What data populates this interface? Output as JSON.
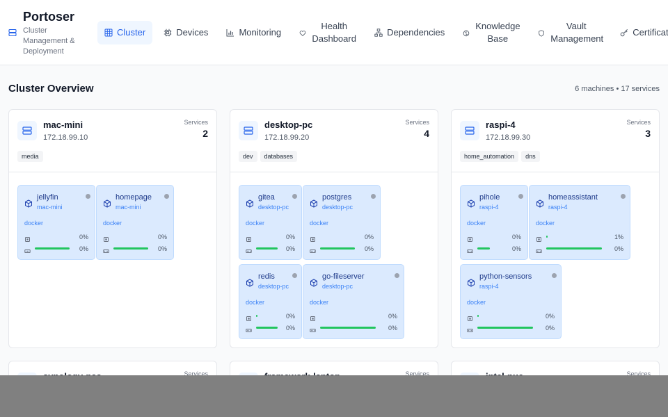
{
  "brand": {
    "title": "Portoser",
    "subtitle": "Cluster Management & Deployment",
    "logo_icon": "server-stack-icon"
  },
  "nav": [
    {
      "label": "Cluster",
      "icon": "grid-icon",
      "active": true
    },
    {
      "label": "Devices",
      "icon": "chip-icon",
      "active": false
    },
    {
      "label": "Monitoring",
      "icon": "bar-chart-icon",
      "active": false
    },
    {
      "label": "Health Dashboard",
      "icon": "heart-icon",
      "active": false
    },
    {
      "label": "Dependencies",
      "icon": "network-icon",
      "active": false
    },
    {
      "label": "Knowledge Base",
      "icon": "brain-icon",
      "active": false
    },
    {
      "label": "Vault Management",
      "icon": "shield-icon",
      "active": false
    },
    {
      "label": "Certificates",
      "icon": "key-icon",
      "active": false
    }
  ],
  "overview": {
    "title": "Cluster Overview",
    "meta": "6 machines • 17 services"
  },
  "colors": {
    "accent": "#2563eb",
    "service_bg": "#dbeafe",
    "bar_fill": "#22c55e",
    "status_dot": "#9ca3af"
  },
  "machines": [
    {
      "name": "mac-mini",
      "ip": "172.18.99.10",
      "services_label": "Services",
      "services_count": "2",
      "tags": [
        "media"
      ],
      "services": [
        {
          "name": "jellyfin",
          "host": "mac-mini",
          "runtime": "docker",
          "cpu": "0%",
          "mem": "0%",
          "cpu_level": 0,
          "mem_level": 0.9
        },
        {
          "name": "homepage",
          "host": "mac-mini",
          "runtime": "docker",
          "cpu": "0%",
          "mem": "0%",
          "cpu_level": 0,
          "mem_level": 0.9
        }
      ]
    },
    {
      "name": "desktop-pc",
      "ip": "172.18.99.20",
      "services_label": "Services",
      "services_count": "4",
      "tags": [
        "dev",
        "databases"
      ],
      "services": [
        {
          "name": "gitea",
          "host": "desktop-pc",
          "runtime": "docker",
          "cpu": "0%",
          "mem": "0%",
          "cpu_level": 0,
          "mem_level": 0.9
        },
        {
          "name": "postgres",
          "host": "desktop-pc",
          "runtime": "docker",
          "cpu": "0%",
          "mem": "0%",
          "cpu_level": 0,
          "mem_level": 0.9
        },
        {
          "name": "redis",
          "host": "desktop-pc",
          "runtime": "docker",
          "cpu": "0%",
          "mem": "0%",
          "cpu_level": 0.02,
          "mem_level": 0.9
        },
        {
          "name": "go-fileserver",
          "host": "desktop-pc",
          "runtime": "docker",
          "cpu": "0%",
          "mem": "0%",
          "cpu_level": 0,
          "mem_level": 0.9
        }
      ]
    },
    {
      "name": "raspi-4",
      "ip": "172.18.99.30",
      "services_label": "Services",
      "services_count": "3",
      "tags": [
        "home_automation",
        "dns"
      ],
      "services": [
        {
          "name": "pihole",
          "host": "raspi-4",
          "runtime": "docker",
          "cpu": "0%",
          "mem": "0%",
          "cpu_level": 0,
          "mem_level": 0.45
        },
        {
          "name": "homeassistant",
          "host": "raspi-4",
          "runtime": "docker",
          "cpu": "1%",
          "mem": "0%",
          "cpu_level": 0.01,
          "mem_level": 0.9
        },
        {
          "name": "python-sensors",
          "host": "raspi-4",
          "runtime": "docker",
          "cpu": "0%",
          "mem": "0%",
          "cpu_level": 0.01,
          "mem_level": 0.9
        }
      ]
    },
    {
      "name": "synology-nas",
      "services_label": "Services"
    },
    {
      "name": "framework-laptop",
      "services_label": "Services"
    },
    {
      "name": "intel-nuc",
      "services_label": "Services"
    }
  ]
}
